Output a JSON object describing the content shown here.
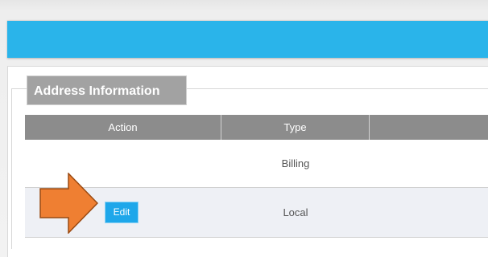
{
  "header": {
    "bar_color": "#2ab4ea"
  },
  "section": {
    "title": "Address Information"
  },
  "table": {
    "columns": [
      "Action",
      "Type",
      ""
    ],
    "rows": [
      {
        "action": "",
        "type": "Billing"
      },
      {
        "action": "Edit",
        "type": "Local"
      }
    ]
  },
  "annotation": {
    "arrow_color": "#ef7f32",
    "arrow_icon": "arrow-right-icon"
  }
}
